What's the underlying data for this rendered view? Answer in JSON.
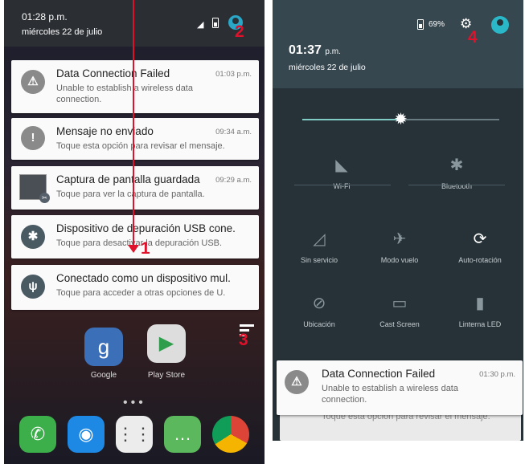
{
  "left": {
    "status": {
      "time": "01:28 p.m.",
      "date": "miércoles 22 de julio"
    },
    "notifications": [
      {
        "icon": "warning-icon",
        "title": "Data Connection Failed",
        "time": "01:03 p.m.",
        "text": "Unable to establish a wireless data connection."
      },
      {
        "icon": "message-alert-icon",
        "title": "Mensaje no enviado",
        "time": "09:34 a.m.",
        "text": "Toque esta opción para revisar el mensaje."
      },
      {
        "icon": "screenshot-thumbnail",
        "title": "Captura de pantalla guardada",
        "time": "09:29 a.m.",
        "text": "Toque para ver la captura de pantalla."
      },
      {
        "icon": "bug-icon",
        "title": "Dispositivo de depuración USB cone.",
        "time": "",
        "text": "Toque para desactivar la depuración USB."
      },
      {
        "icon": "usb-icon",
        "title": "Conectado como un dispositivo mul.",
        "time": "",
        "text": "Toque para acceder a otras opciones de U."
      }
    ],
    "apps": [
      {
        "label": "Google"
      },
      {
        "label": "Play Store"
      }
    ],
    "annotations": {
      "n1": "1",
      "n2": "2",
      "n3": "3"
    }
  },
  "right": {
    "status": {
      "battery": "69%",
      "time": "01:37",
      "time_suffix": "p.m.",
      "date": "miércoles 22 de julio"
    },
    "brightness": 0.5,
    "tiles": [
      {
        "label": "Wi-Fi",
        "icon": "wifi-off-icon"
      },
      {
        "label": "Bluetooth",
        "icon": "bluetooth-off-icon"
      },
      {
        "label": "Sin servicio",
        "icon": "no-signal-icon"
      },
      {
        "label": "Modo vuelo",
        "icon": "airplane-icon"
      },
      {
        "label": "Auto-rotación",
        "icon": "auto-rotate-icon"
      },
      {
        "label": "Ubicación",
        "icon": "location-off-icon"
      },
      {
        "label": "Cast Screen",
        "icon": "cast-icon"
      },
      {
        "label": "Linterna LED",
        "icon": "flashlight-icon"
      }
    ],
    "notification": {
      "title": "Data Connection Failed",
      "time": "01:30 p.m.",
      "text": "Unable to establish a wireless data connection."
    },
    "behind_text": "Toque esta opción para revisar el mensaje.",
    "annotation": "4"
  }
}
